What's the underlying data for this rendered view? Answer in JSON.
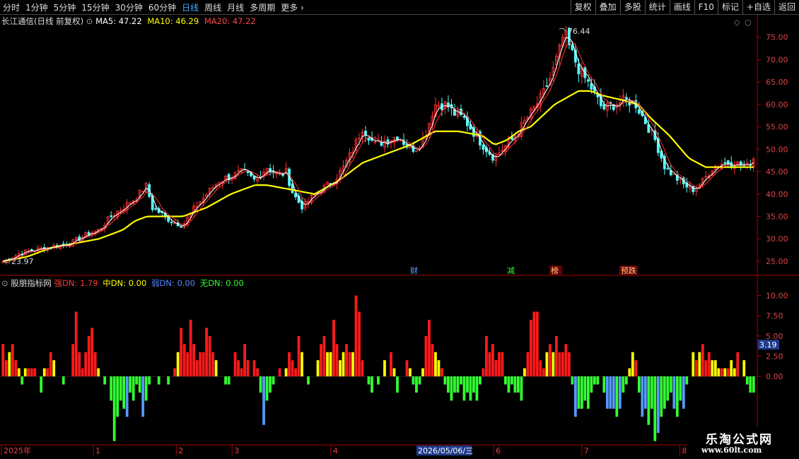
{
  "toolbar": {
    "periods": [
      "分时",
      "1分钟",
      "5分钟",
      "15分钟",
      "30分钟",
      "60分钟",
      "日线",
      "周线",
      "月线",
      "多周期",
      "更多"
    ],
    "active_period": "日线",
    "buttons": [
      "复权",
      "叠加",
      "多股",
      "统计",
      "画线",
      "F10",
      "标记",
      "+自选",
      "返回"
    ]
  },
  "main": {
    "stock_title": "长江通信(日线 前复权)",
    "ma5_label": "MA5: 47.22",
    "ma10_label": "MA10: 46.29",
    "ma20_label": "MA20: 47.22",
    "high_label": "76.44",
    "low_label": "23.97",
    "events": [
      "财",
      "减",
      "榜",
      "预跌"
    ],
    "colors": {
      "ma5": "#ffffff",
      "ma10": "#ffff00",
      "ma20": "#ff3030",
      "up": "#ff3030",
      "down": "#54ffff",
      "bg": "#000000"
    }
  },
  "indicator": {
    "title": "股朋指标网",
    "strong_label": "强DN: 1.79",
    "mid_label": "中DN: 0.00",
    "weak_label": "弱DN: 0.00",
    "none_label": "无DN: 0.00",
    "current_value": "3.19",
    "colors": {
      "strong": "#ff1a1a",
      "mid": "#ffff00",
      "weak": "#5599ff",
      "none": "#33ff33"
    }
  },
  "axis": {
    "price_ticks": [
      "75.00",
      "70.00",
      "65.00",
      "60.00",
      "55.00",
      "50.00",
      "45.00",
      "40.00",
      "35.00",
      "30.00",
      "25.00"
    ],
    "ind_ticks": [
      "10.00",
      "7.50",
      "5.00",
      "2.50",
      "0.00"
    ],
    "date_labels": [
      "2025年",
      "1",
      "2",
      "3",
      "4",
      "6",
      "7",
      "8"
    ],
    "cursor_date": "2026/05/06/三"
  },
  "watermark": {
    "line1": "乐淘公式网",
    "line2": "www.60lt.com"
  },
  "chart_data": [
    {
      "type": "candlestick",
      "title": "长江通信(日线 前复权)",
      "ylim": [
        22,
        80
      ],
      "yticks": [
        25,
        30,
        35,
        40,
        45,
        50,
        55,
        60,
        65,
        70,
        75
      ],
      "high": 76.44,
      "low": 23.97,
      "close_path": [
        [
          0,
          25
        ],
        [
          8,
          27
        ],
        [
          18,
          28
        ],
        [
          28,
          29
        ],
        [
          35,
          31
        ],
        [
          40,
          32
        ],
        [
          45,
          35
        ],
        [
          50,
          37
        ],
        [
          55,
          39
        ],
        [
          60,
          42
        ],
        [
          62,
          37
        ],
        [
          65,
          36
        ],
        [
          70,
          34
        ],
        [
          75,
          33
        ],
        [
          80,
          37
        ],
        [
          85,
          40
        ],
        [
          90,
          43
        ],
        [
          95,
          44
        ],
        [
          100,
          45
        ],
        [
          105,
          43
        ],
        [
          110,
          46
        ],
        [
          115,
          44
        ],
        [
          118,
          45
        ],
        [
          121,
          40
        ],
        [
          125,
          37
        ],
        [
          130,
          40
        ],
        [
          138,
          43
        ],
        [
          142,
          46
        ],
        [
          146,
          50
        ],
        [
          150,
          55
        ],
        [
          155,
          51
        ],
        [
          160,
          52
        ],
        [
          165,
          53
        ],
        [
          168,
          51
        ],
        [
          172,
          50
        ],
        [
          176,
          53
        ],
        [
          180,
          60
        ],
        [
          185,
          60
        ],
        [
          188,
          58
        ],
        [
          192,
          57
        ],
        [
          196,
          54
        ],
        [
          200,
          51
        ],
        [
          205,
          48
        ],
        [
          208,
          50
        ],
        [
          212,
          52
        ],
        [
          216,
          55
        ],
        [
          220,
          58
        ],
        [
          225,
          62
        ],
        [
          229,
          67
        ],
        [
          232,
          72
        ],
        [
          234,
          76
        ],
        [
          236,
          73
        ],
        [
          240,
          68
        ],
        [
          245,
          64
        ],
        [
          250,
          59
        ],
        [
          255,
          60
        ],
        [
          260,
          61
        ],
        [
          264,
          60
        ],
        [
          268,
          56
        ],
        [
          272,
          52
        ],
        [
          276,
          46
        ],
        [
          280,
          44
        ],
        [
          284,
          42
        ],
        [
          288,
          41
        ],
        [
          292,
          43
        ],
        [
          296,
          46
        ],
        [
          300,
          47
        ],
        [
          305,
          47
        ],
        [
          310,
          46
        ],
        [
          313,
          48
        ]
      ],
      "ma20_path": [
        [
          0,
          25
        ],
        [
          10,
          26
        ],
        [
          20,
          28
        ],
        [
          30,
          29
        ],
        [
          40,
          30
        ],
        [
          50,
          32
        ],
        [
          55,
          34
        ],
        [
          60,
          35
        ],
        [
          65,
          35
        ],
        [
          70,
          35
        ],
        [
          75,
          35
        ],
        [
          85,
          37
        ],
        [
          95,
          40
        ],
        [
          105,
          42
        ],
        [
          110,
          42
        ],
        [
          120,
          41
        ],
        [
          130,
          40
        ],
        [
          140,
          43
        ],
        [
          150,
          47
        ],
        [
          160,
          49
        ],
        [
          170,
          51
        ],
        [
          180,
          54
        ],
        [
          190,
          54
        ],
        [
          200,
          53
        ],
        [
          205,
          51
        ],
        [
          210,
          52
        ],
        [
          215,
          54
        ],
        [
          220,
          55
        ],
        [
          230,
          60
        ],
        [
          240,
          63
        ],
        [
          245,
          63
        ],
        [
          250,
          62
        ],
        [
          258,
          61
        ],
        [
          265,
          60
        ],
        [
          270,
          57
        ],
        [
          278,
          53
        ],
        [
          286,
          48
        ],
        [
          293,
          46
        ],
        [
          300,
          46
        ],
        [
          306,
          46
        ],
        [
          313,
          46
        ]
      ]
    },
    {
      "type": "bar",
      "title": "股朋指标网",
      "ylim": [
        -8,
        12
      ],
      "yticks": [
        0,
        2.5,
        5,
        7.5,
        10
      ],
      "series": [
        {
          "name": "强DN",
          "value": 1.79
        },
        {
          "name": "中DN",
          "value": 0.0
        },
        {
          "name": "弱DN",
          "value": 0.0
        },
        {
          "name": "无DN",
          "value": 0.0
        }
      ],
      "values": [
        4,
        2,
        3,
        4,
        2,
        1,
        -1,
        1,
        1,
        1,
        1,
        0,
        -2,
        1,
        1,
        3,
        2,
        0,
        0,
        -1,
        0,
        0,
        4,
        8,
        3,
        1,
        3,
        5,
        6,
        3,
        1,
        0,
        -1,
        0,
        -3,
        -8,
        -5,
        -3,
        -4,
        -5,
        -2,
        -3,
        -1,
        -2,
        -5,
        -3,
        -1,
        0,
        0,
        -1,
        0,
        0,
        -1,
        0,
        1,
        3,
        6,
        4,
        3,
        7,
        4,
        2,
        3,
        3,
        6,
        5,
        3,
        2,
        0,
        0,
        -1,
        -1,
        0,
        3,
        2,
        1,
        4,
        2,
        0,
        2,
        1,
        -2,
        -6,
        -3,
        -2,
        -1,
        0,
        1,
        0,
        1,
        3,
        2,
        1,
        5,
        3,
        0,
        -1,
        0,
        0,
        2,
        4,
        5,
        3,
        3,
        7,
        4,
        2,
        3,
        4,
        3,
        3,
        10,
        8,
        2,
        0,
        -1,
        -2,
        0,
        -1,
        0,
        2,
        0,
        3,
        1,
        -2,
        0,
        0,
        2,
        1,
        -1,
        -2,
        -1,
        1,
        5,
        7,
        4,
        3,
        2,
        1,
        -1,
        -2,
        -3,
        -2,
        -2,
        -1,
        -3,
        -2,
        -3,
        -2,
        -3,
        -1,
        1,
        5,
        3,
        4,
        2,
        3,
        3,
        -1,
        -2,
        -1,
        -2,
        -2,
        -3,
        1,
        3,
        7,
        8,
        8,
        2,
        1,
        3,
        4,
        3,
        5,
        3,
        3,
        4,
        3,
        -1,
        -5,
        -4,
        -4,
        -3,
        -4,
        -2,
        -1,
        -1,
        0,
        -2,
        -4,
        -4,
        -4,
        -5,
        -4,
        -2,
        -1,
        1,
        3,
        2,
        -2,
        -5,
        -4,
        -6,
        -4,
        -8,
        -7,
        -5,
        -4,
        -3,
        -2,
        -4,
        -5,
        -3,
        -4,
        -1,
        0,
        3,
        2,
        3,
        4,
        2,
        3,
        2,
        2,
        1,
        1,
        1,
        1,
        2,
        1,
        3,
        0,
        2,
        -1,
        -2,
        -2
      ]
    }
  ]
}
